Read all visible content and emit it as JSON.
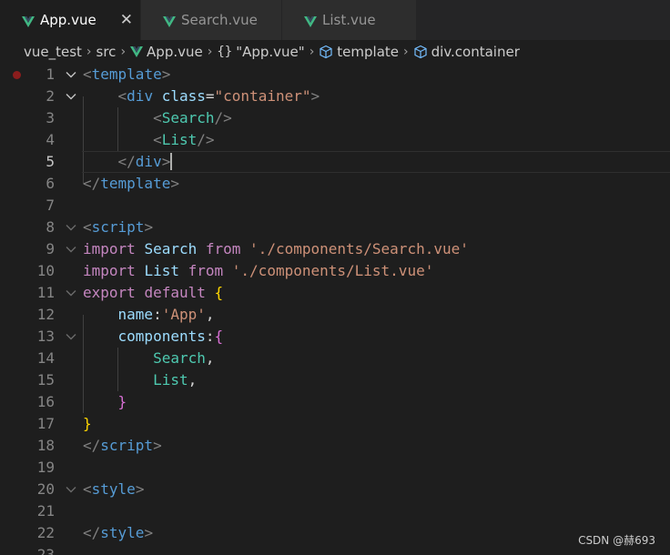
{
  "tabs": [
    {
      "label": "App.vue",
      "active": true,
      "close": "✕"
    },
    {
      "label": "Search.vue",
      "active": false
    },
    {
      "label": "List.vue",
      "active": false
    }
  ],
  "breadcrumb": {
    "folder1": "vue_test",
    "folder2": "src",
    "file": "App.vue",
    "braces": "{}",
    "object": "\"App.vue\"",
    "template": "template",
    "element": "div.container"
  },
  "editor": {
    "line_numbers": [
      "1",
      "2",
      "3",
      "4",
      "5",
      "6",
      "7",
      "8",
      "9",
      "10",
      "11",
      "12",
      "13",
      "14",
      "15",
      "16",
      "17",
      "18",
      "19",
      "20",
      "21",
      "22",
      "23"
    ],
    "current_line": 5
  },
  "tokens": {
    "l1": [
      "<",
      "template",
      ">"
    ],
    "l2": [
      "<",
      "div",
      "class",
      "=",
      "\"container\"",
      ">"
    ],
    "l3": [
      "<",
      "Search",
      "/>"
    ],
    "l4": [
      "<",
      "List",
      "/>"
    ],
    "l5": [
      "</",
      "div",
      ">"
    ],
    "l6": [
      "</",
      "template",
      ">"
    ],
    "l8": [
      "<",
      "script",
      ">"
    ],
    "l9": [
      "import",
      "Search",
      "from",
      "'./components/Search.vue'"
    ],
    "l10": [
      "import",
      "List",
      "from",
      "'./components/List.vue'"
    ],
    "l11": [
      "export",
      "default",
      "{"
    ],
    "l12": [
      "name",
      ":",
      "'App'",
      ","
    ],
    "l13": [
      "components",
      ":",
      "{"
    ],
    "l14": [
      "Search",
      ","
    ],
    "l15": [
      "List",
      ","
    ],
    "l16": [
      "}"
    ],
    "l17": [
      "}"
    ],
    "l18": [
      "</",
      "script",
      ">"
    ],
    "l20": [
      "<",
      "style",
      ">"
    ],
    "l22": [
      "</",
      "style",
      ">"
    ]
  },
  "watermark": "CSDN @赫693",
  "colors": {
    "background": "#1e1e1e",
    "tag": "#569cd6",
    "component": "#4ec9b0",
    "attribute": "#9cdcfe",
    "string": "#ce9178",
    "keyword": "#c586c0",
    "vue_green": "#41b883"
  }
}
